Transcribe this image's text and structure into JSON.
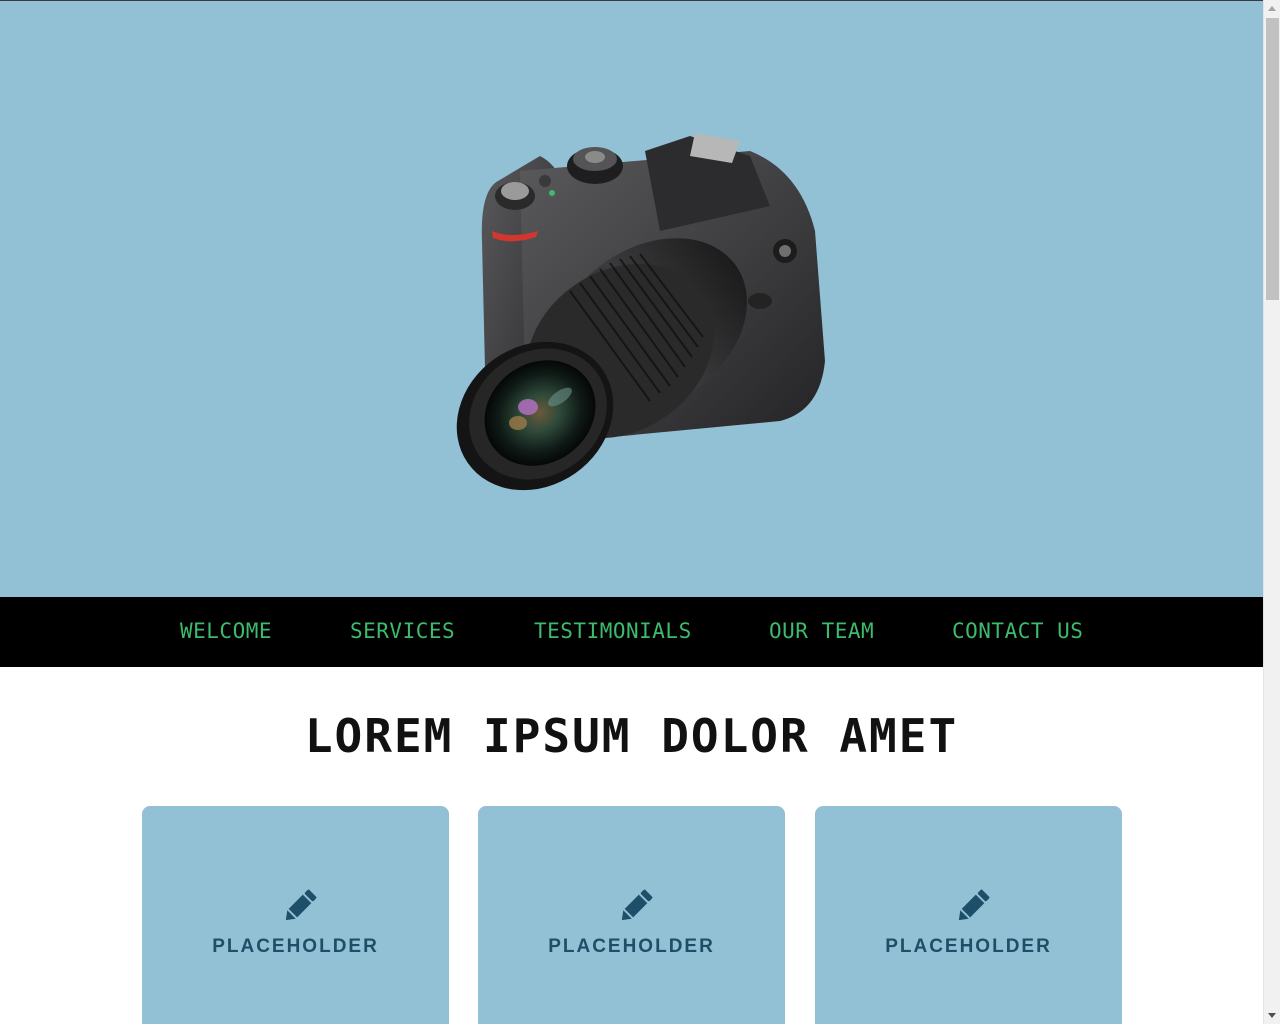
{
  "hero": {
    "image": "camera-photo",
    "background_color": "#92c1d6"
  },
  "nav": {
    "items": [
      "WELCOME",
      "SERVICES",
      "TESTIMONIALS",
      "OUR TEAM",
      "CONTACT US"
    ],
    "text_color": "#3dbb6c",
    "background_color": "#000000"
  },
  "main": {
    "heading": "LOREM IPSUM DOLOR AMET",
    "cards": [
      {
        "icon": "pencil-icon",
        "label": "PLACEHOLDER"
      },
      {
        "icon": "pencil-icon",
        "label": "PLACEHOLDER"
      },
      {
        "icon": "pencil-icon",
        "label": "PLACEHOLDER"
      }
    ],
    "card_color": "#92c1d6",
    "card_text_color": "#1d5068"
  }
}
